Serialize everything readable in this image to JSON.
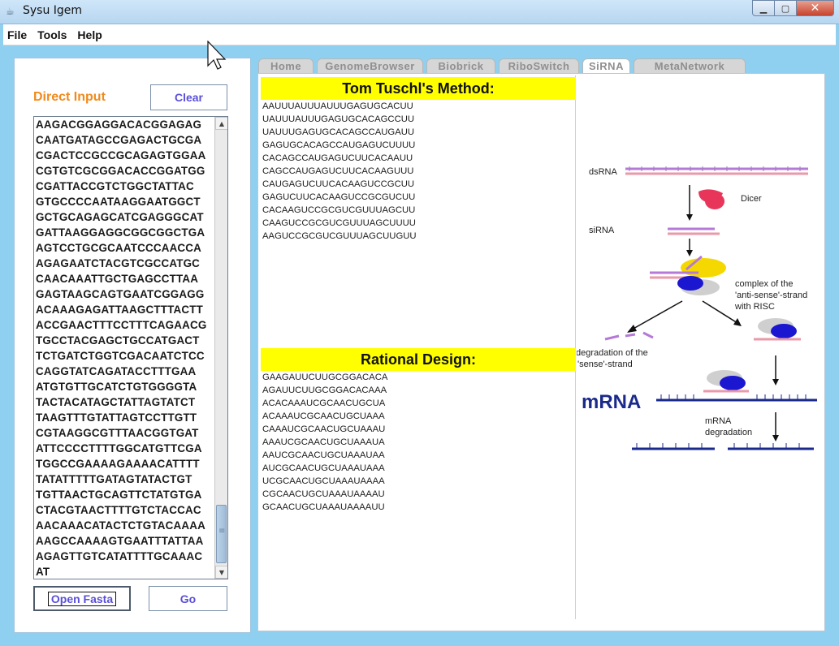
{
  "window": {
    "title": "Sysu Igem"
  },
  "menu": {
    "file": "File",
    "tools": "Tools",
    "help": "Help"
  },
  "left_panel": {
    "direct_input_label": "Direct Input",
    "clear_button": "Clear",
    "open_fasta_button": "Open Fasta",
    "go_button": "Go",
    "sequence": "AAGACGGAGGACACGGAGAG\nCAATGATAGCCGAGACTGCGA\nCGACTCCGCCGCAGAGTGGAA\nCGTGTCGCGGACACCGGATGG\nCGATTACCGTCTGGCTATTAC\nGTGCCCCAATAAGGAATGGCT\nGCTGCAGAGCATCGAGGGCAT\nGATTAAGGAGGCGGCGGCTGA\nAGTCCTGCGCAATCCCAACCA\nAGAGAATCTACGTCGCCATGC\nCAACAAATTGCTGAGCCTTAA\nGAGTAAGCAGTGAATCGGAGG\nACAAAGAGATTAAGCTTTACTT\nACCGAACTTTCCTTTCAGAACG\nTGCCTACGAGCTGCCATGACT\nTCTGATCTGGTCGACAATCTCC\nCAGGTATCAGATACCTTTGAA\nATGTGTTGCATCTGTGGGGTA\nTACTACATAGCTATTAGTATCT\nTAAGTTTGTATTAGTCCTTGTT\nCGTAAGGCGTTTAACGGTGAT\nATTCCCCTTTTGGCATGTTCGA\nTGGCCGAAAAGAAAACATTTT\nTATATTTTTGATAGTATACTGT\nTGTTAACTGCAGTTCTATGTGA\nCTACGTAACTTTTGTCTACCAC\nAACAAACATACTCTGTACAAAA\nAAGCCAAAAGTGAATTTATTAA\nAGAGTTGTCATATTTTGCAAAC\nAT"
  },
  "tabs": [
    {
      "label": "Home",
      "active": false
    },
    {
      "label": "GenomeBrowser",
      "active": false
    },
    {
      "label": "Biobrick",
      "active": false
    },
    {
      "label": "RiboSwitch",
      "active": false
    },
    {
      "label": "SiRNA",
      "active": true
    },
    {
      "label": "MetaNetwork",
      "active": false
    }
  ],
  "sirna": {
    "method1_title": "Tom Tuschl's Method:",
    "method1_sequences": [
      "AAUUUAUUUAUUUGAGUGCACUU",
      "UAUUUAUUUGAGUGCACAGCCUU",
      "UAUUUGAGUGCACAGCCAUGAUU",
      "GAGUGCACAGCCAUGAGUCUUUU",
      "CACAGCCAUGAGUCUUCACAAUU",
      "CAGCCAUGAGUCUUCACAAGUUU",
      "CAUGAGUCUUCACAAGUCCGCUU",
      "GAGUCUUCACAAGUCCGCGUCUU",
      "CACAAGUCCGCGUCGUUUAGCUU",
      "CAAGUCCGCGUCGUUUAGCUUUU",
      "AAGUCCGCGUCGUUUAGCUUGUU"
    ],
    "method2_title": "Rational Design:",
    "method2_sequences": [
      "GAAGAUUCUUGCGGACACA",
      "AGAUUCUUGCGGACACAAA",
      "ACACAAAUCGCAACUGCUA",
      "ACAAAUCGCAACUGCUAAA",
      "CAAAUCGCAACUGCUAAAU",
      "AAAUCGCAACUGCUAAAUA",
      "AAUCGCAACUGCUAAAUAA",
      "AUCGCAACUGCUAAAUAAA",
      "UCGCAACUGCUAAAUAAAA",
      "CGCAACUGCUAAAUAAAAU",
      "GCAACUGCUAAAUAAAAUU"
    ]
  },
  "diagram": {
    "dsrna": "dsRNA",
    "dicer": "Dicer",
    "sirna": "siRNA",
    "complex_line1": "complex of the",
    "complex_line2": "'anti-sense'-strand",
    "complex_line3": "with RISC",
    "degradation_line1": "degradation of the",
    "degradation_line2": "'sense'-strand",
    "mrna": "mRNA",
    "mrna_deg_line1": "mRNA",
    "mrna_deg_line2": "degradation"
  },
  "colors": {
    "accent_orange": "#f08a1c",
    "button_text": "#5a4fd8",
    "header_yellow": "#ffff00",
    "mrna_blue": "#1a2a8a"
  }
}
